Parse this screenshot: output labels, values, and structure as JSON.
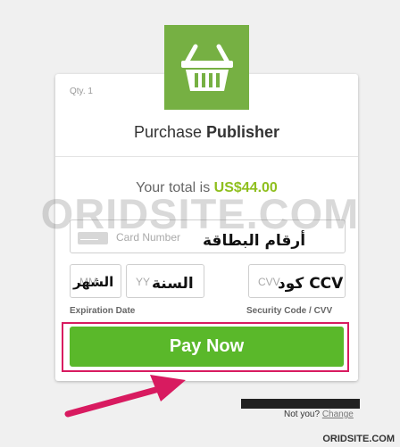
{
  "checkout": {
    "qty": "Qty. 1",
    "title_prefix": "Purchase",
    "title_product": "Publisher",
    "total_label": "Your total is",
    "total_amount": "US$44.00"
  },
  "fields": {
    "card_number_placeholder": "Card Number",
    "card_number_overlay": "أرقام البطاقة",
    "month_placeholder": "MM",
    "month_overlay": "الشهر",
    "year_placeholder": "YY",
    "year_overlay": "السنة",
    "cvv_placeholder": "CVV",
    "cvv_overlay": "كود CCV",
    "expiration_label": "Expiration Date",
    "security_label": "Security Code / CVV"
  },
  "actions": {
    "pay_label": "Pay Now",
    "not_you": "Not you?",
    "change": "Change"
  },
  "watermarks": {
    "center": "ORIDSITE.COM",
    "bottom": "ORIDSITE.COM"
  },
  "colors": {
    "brand_green": "#76b043",
    "pay_green": "#5ab82a",
    "total_green": "#8fbf1e",
    "annotation_pink": "#d81b60"
  }
}
